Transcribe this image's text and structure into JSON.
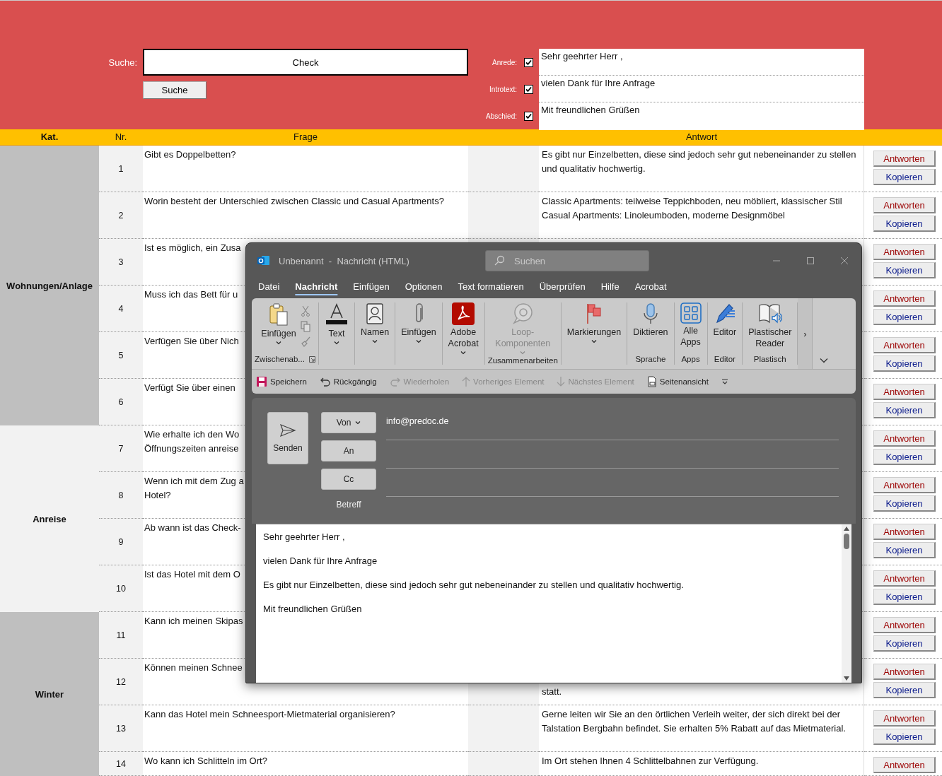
{
  "header": {
    "search_label": "Suche:",
    "search_value": "Check",
    "search_button": "Suche",
    "options": [
      {
        "label": "Anrede:",
        "checked": true,
        "text": "Sehr geehrter Herr ,"
      },
      {
        "label": "Introtext:",
        "checked": true,
        "text": "vielen Dank für Ihre Anfrage"
      },
      {
        "label": "Abschied:",
        "checked": true,
        "text": "Mit freundlichen Grüßen"
      }
    ]
  },
  "columns": [
    {
      "label": "Kat.",
      "bold": true
    },
    {
      "label": "Nr.",
      "bold": false
    },
    {
      "label": "Frage",
      "bold": false
    },
    {
      "label": "Antwort",
      "bold": false
    }
  ],
  "categories": [
    {
      "name": "Wohnungen/Anlage",
      "color": "#bfbfbf",
      "rows": [
        {
          "nr": "1",
          "question": "Gibt es  Doppelbetten?",
          "answer": "Es gibt nur Einzelbetten, diese sind jedoch sehr gut nebeneinander zu stellen und qualitativ hochwertig.",
          "buttons": [
            {
              "label": "Antworten",
              "kind": "answer"
            },
            {
              "label": "Kopieren",
              "kind": "copy"
            }
          ]
        },
        {
          "nr": "2",
          "question": "Worin besteht der Unterschied zwischen Classic und Casual Apartments?",
          "answer": "Classic Apartments: teilweise Teppichboden, neu möbliert, klassischer Stil\nCasual Apartments: Linoleumboden, moderne Designmöbel",
          "buttons": [
            {
              "label": "Antworten",
              "kind": "answer"
            },
            {
              "label": "Kopieren",
              "kind": "copy"
            }
          ]
        },
        {
          "nr": "3",
          "question": "Ist es möglich, ein Zusa",
          "buttons": [
            {
              "label": "Antworten",
              "kind": "answer"
            },
            {
              "label": "Kopieren",
              "kind": "copy"
            }
          ]
        },
        {
          "nr": "4",
          "question": "Muss ich das Bett für u",
          "buttons": [
            {
              "label": "Antworten",
              "kind": "answer"
            },
            {
              "label": "Kopieren",
              "kind": "copy"
            }
          ]
        },
        {
          "nr": "5",
          "question": "Verfügen Sie  über Nich",
          "buttons": [
            {
              "label": "Antworten",
              "kind": "answer"
            },
            {
              "label": "Kopieren",
              "kind": "copy"
            }
          ]
        },
        {
          "nr": "6",
          "question": "Verfügt Sie über einen",
          "buttons": [
            {
              "label": "Antworten",
              "kind": "answer"
            },
            {
              "label": "Kopieren",
              "kind": "copy"
            }
          ]
        }
      ]
    },
    {
      "name": "Anreise",
      "color": "#f2f2f2",
      "rows": [
        {
          "nr": "7",
          "question": "Wie erhalte ich den Wo\nÖffnungszeiten anreise",
          "buttons": [
            {
              "label": "Antworten",
              "kind": "answer"
            },
            {
              "label": "Kopieren",
              "kind": "copy"
            }
          ]
        },
        {
          "nr": "8",
          "question": "Wenn ich mit dem Zug a\nHotel?",
          "buttons": [
            {
              "label": "Antworten",
              "kind": "answer"
            },
            {
              "label": "Kopieren",
              "kind": "copy"
            }
          ]
        },
        {
          "nr": "9",
          "question": "Ab wann ist das Check-",
          "buttons": [
            {
              "label": "Antworten",
              "kind": "answer"
            },
            {
              "label": "Kopieren",
              "kind": "copy"
            }
          ]
        },
        {
          "nr": "10",
          "question": "Ist das Hotel mit dem O",
          "buttons": [
            {
              "label": "Antworten",
              "kind": "answer"
            },
            {
              "label": "Kopieren",
              "kind": "copy"
            }
          ]
        }
      ]
    },
    {
      "name": "Winter",
      "color": "#bfbfbf",
      "rows": [
        {
          "nr": "11",
          "question": "Kann ich meinen Skipas",
          "buttons": [
            {
              "label": "Antworten",
              "kind": "answer"
            },
            {
              "label": "Kopieren",
              "kind": "copy"
            }
          ]
        },
        {
          "nr": "12",
          "question": "Können meinen Schnee",
          "answer": "statt.",
          "answer_continued": true,
          "buttons": [
            {
              "label": "Antworten",
              "kind": "answer"
            },
            {
              "label": "Kopieren",
              "kind": "copy"
            }
          ]
        },
        {
          "nr": "13",
          "question": "Kann das Hotel mein Schneesport-Mietmaterial organisieren?",
          "answer": "Gerne leiten wir Sie an den örtlichen Verleih weiter, der sich direkt bei der Talstation Bergbahn befindet. Sie erhalten 5% Rabatt auf das Mietmaterial.",
          "buttons": [
            {
              "label": "Antworten",
              "kind": "answer"
            },
            {
              "label": "Kopieren",
              "kind": "copy"
            }
          ]
        },
        {
          "nr": "14",
          "question": "Wo kann ich Schlitteln im Ort?",
          "answer": "Im Ort stehen Ihnen 4 Schlittelbahnen zur Verfügung.",
          "buttons": [
            {
              "label": "Antworten",
              "kind": "answer"
            }
          ]
        }
      ]
    }
  ],
  "dialog": {
    "title": "Unbenannt  -  Nachricht (HTML)",
    "search_placeholder": "Suchen",
    "tabs": [
      {
        "label": "Datei",
        "selected": false
      },
      {
        "label": "Nachricht",
        "selected": true
      },
      {
        "label": "Einfügen",
        "selected": false
      },
      {
        "label": "Optionen",
        "selected": false
      },
      {
        "label": "Text formatieren",
        "selected": false
      },
      {
        "label": "Überprüfen",
        "selected": false
      },
      {
        "label": "Hilfe",
        "selected": false
      },
      {
        "label": "Acrobat",
        "selected": false
      }
    ],
    "ribbon": [
      {
        "group": "Zwischenab...",
        "items": [
          {
            "label": "Einfügen",
            "dropdown": true,
            "disabled": false
          }
        ]
      },
      {
        "items": [
          {
            "label": "Text",
            "dropdown": true,
            "disabled": false
          }
        ]
      },
      {
        "items": [
          {
            "label": "Namen",
            "dropdown": true,
            "disabled": false
          }
        ]
      },
      {
        "items": [
          {
            "label": "Einfügen",
            "dropdown": true,
            "disabled": false
          }
        ]
      },
      {
        "items": [
          {
            "label": "Adobe\nAcrobat",
            "dropdown": true,
            "disabled": false
          }
        ]
      },
      {
        "group": "Zusammenarbeiten",
        "items": [
          {
            "label": "Loop-\nKomponenten",
            "dropdown": true,
            "disabled": true
          }
        ]
      },
      {
        "items": [
          {
            "label": "Markierungen",
            "dropdown": true,
            "disabled": false
          }
        ]
      },
      {
        "group": "Sprache",
        "items": [
          {
            "label": "Diktieren",
            "dropdown": false,
            "disabled": false
          }
        ]
      },
      {
        "group": "Apps",
        "items": [
          {
            "label": "Alle\nApps",
            "dropdown": false,
            "disabled": false
          }
        ]
      },
      {
        "group": "Editor",
        "items": [
          {
            "label": "Editor",
            "dropdown": false,
            "disabled": false
          }
        ]
      },
      {
        "group": "Plastisch",
        "items": [
          {
            "label": "Plastischer\nReader",
            "dropdown": false,
            "disabled": false
          }
        ]
      }
    ],
    "more": "›",
    "quick_access": [
      {
        "label": "Speichern",
        "disabled": false
      },
      {
        "label": "Rückgängig",
        "disabled": false
      },
      {
        "label": "Wiederholen",
        "disabled": true
      },
      {
        "label": "Vorheriges Element",
        "disabled": true
      },
      {
        "label": "Nächstes Element",
        "disabled": true
      },
      {
        "label": "Seitenansicht",
        "disabled": false
      }
    ],
    "send": "Senden",
    "fields": [
      {
        "label": "Von",
        "dropdown": true,
        "value": "info@predoc.de"
      },
      {
        "label": "An",
        "dropdown": false
      },
      {
        "label": "Cc",
        "dropdown": false
      }
    ],
    "subject_label": "Betreff",
    "body": [
      "Sehr geehrter Herr ,",
      "vielen Dank für Ihre Anfrage",
      "Es gibt nur Einzelbetten, diese sind jedoch sehr gut nebeneinander zu stellen und qualitativ hochwertig.",
      "Mit freundlichen Grüßen"
    ]
  }
}
